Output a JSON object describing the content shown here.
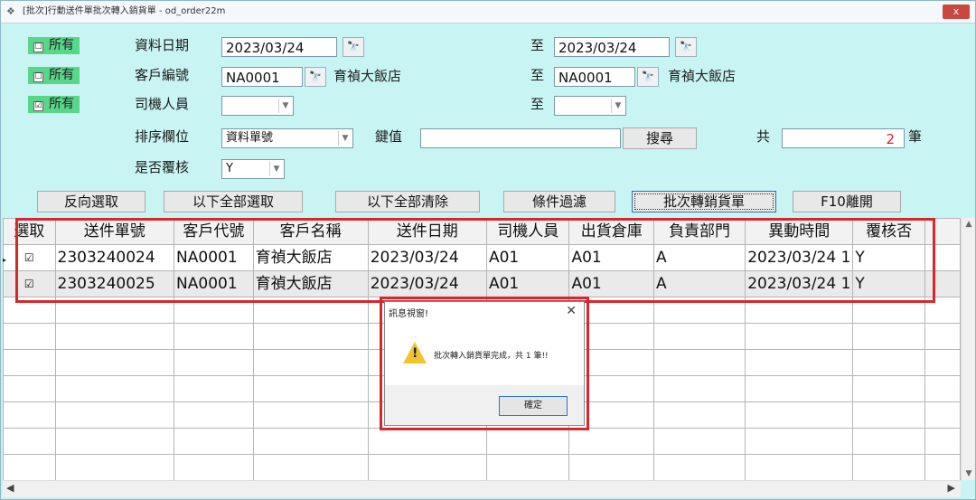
{
  "window": {
    "title": "[批次]行動送件單批次轉入銷貨單 - od_order22m",
    "close_label": "x"
  },
  "filters": {
    "all_label": "所有",
    "date": {
      "label": "資料日期",
      "from": "2023/03/24",
      "to_label": "至",
      "to": "2023/03/24"
    },
    "customer": {
      "label": "客戶編號",
      "from": "NA0001",
      "from_name": "育禎大飯店",
      "to_label": "至",
      "to": "NA0001",
      "to_name": "育禎大飯店"
    },
    "driver": {
      "label": "司機人員",
      "from": "",
      "to_label": "至",
      "to": ""
    },
    "sort": {
      "label": "排序欄位",
      "value": "資料單號",
      "key_label": "鍵值",
      "key_value": "",
      "search_label": "搜尋",
      "total_label": "共",
      "total_value": "2",
      "unit_label": "筆"
    },
    "review": {
      "label": "是否覆核",
      "value": "Y"
    },
    "checks": [
      "☐",
      "☐",
      "☑"
    ]
  },
  "buttons": {
    "reverse": "反向選取",
    "select_all": "以下全部選取",
    "clear_all": "以下全部清除",
    "filter": "條件過濾",
    "batch": "批次轉銷貨單",
    "exit": "F10離開"
  },
  "grid": {
    "headers": [
      "選取",
      "送件單號",
      "客戶代號",
      "客戶名稱",
      "送件日期",
      "司機人員",
      "出貨倉庫",
      "負責部門",
      "異動時間",
      "覆核否"
    ],
    "rows": [
      [
        "☑",
        "2303240024",
        "NA0001",
        "育禎大飯店",
        "2023/03/24",
        "A01",
        "A01",
        "A",
        "2023/03/24 1",
        "Y"
      ],
      [
        "☑",
        "2303240025",
        "NA0001",
        "育禎大飯店",
        "2023/03/24",
        "A01",
        "A01",
        "A",
        "2023/03/24 1",
        "Y"
      ]
    ],
    "row_marker": "▸"
  },
  "dialog": {
    "title": "訊息視窗!",
    "close": "✕",
    "message": "批次轉入銷貨單完成，共 1 筆!!",
    "ok": "確定"
  },
  "icons": {
    "app": "app-icon",
    "picker": "binoculars-icon",
    "dropdown": "chevron-down-icon",
    "warning": "warning-icon"
  },
  "colors": {
    "window_bg": "#c9f4f4",
    "all_badge": "#58d68a",
    "highlight_border": "#d8262c",
    "count_text": "#d22222"
  }
}
